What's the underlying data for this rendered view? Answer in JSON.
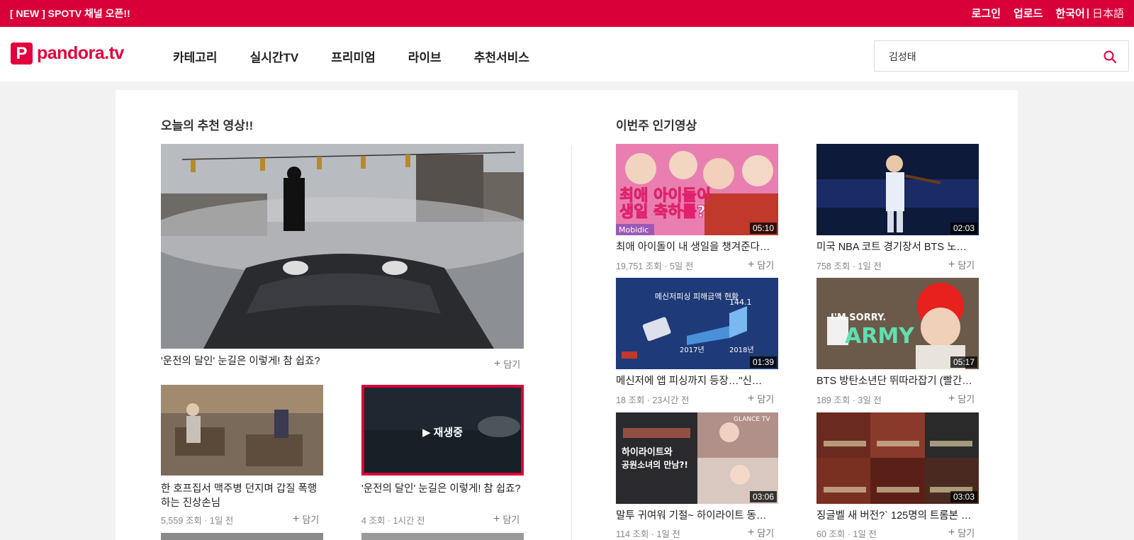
{
  "topbar": {
    "promo": "[ NEW ] SPOTV 채널 오픈!!",
    "login": "로그인",
    "upload": "업로드",
    "lang_ko": "한국어",
    "lang_sep": "|",
    "lang_jp": "日本語"
  },
  "header": {
    "logo_mark": "P",
    "logo_text": "pandora.tv",
    "nav": [
      "카테고리",
      "실시간TV",
      "프리미엄",
      "라이브",
      "추천서비스"
    ],
    "search_value": "김성태"
  },
  "recommended": {
    "title": "오늘의 추천 영상!!",
    "featured": {
      "title": "'운전의 달인' 눈길은 이렇게! 참 쉽죠?",
      "save": "담기"
    },
    "items": [
      {
        "title": "한 호프집서 맥주병 던지며 갑질 폭행하는 진상손님",
        "meta": "5,559 조회 · 1일 전",
        "save": "담기"
      },
      {
        "title": "'운전의 달인' 눈길은 이렇게! 참 쉽죠?",
        "meta": "4 조회 · 1시간 전",
        "save": "담기",
        "playing_label": "▶ 재생중"
      }
    ]
  },
  "popular": {
    "title": "이번주 인기영상",
    "items": [
      {
        "title": "최애 아이돌이 내 생일을 챙겨준다…",
        "meta": "19,751 조회 · 5일 전",
        "duration": "05:10",
        "save": "담기"
      },
      {
        "title": "미국 NBA 코트 경기장서 BTS 노…",
        "meta": "758 조회 · 1일 전",
        "duration": "02:03",
        "save": "담기"
      },
      {
        "title": "메신저에 앱 피싱까지 등장…\"신…",
        "meta": "18 조회 · 23시간 전",
        "duration": "01:39",
        "save": "담기"
      },
      {
        "title": "BTS 방탄소년단 뛰따라잡기 (빨간…",
        "meta": "189 조회 · 3일 전",
        "duration": "05:17",
        "save": "담기"
      },
      {
        "title": "말투 귀여워 기절~ 하이라이트 동…",
        "meta": "114 조회 · 1일 전",
        "duration": "03:06",
        "save": "담기"
      },
      {
        "title": "징글벨 새 버전?` 125명의 트롬본 …",
        "meta": "60 조회 · 1일 전",
        "duration": "03:03",
        "save": "담기"
      }
    ]
  },
  "thumb_texts": {
    "p1_line1": "최애 아이돌이",
    "p1_line2": "생일 축하를?",
    "p1_brand": "Mobidic",
    "p3_head": "메신저피싱 피해금액 현황",
    "p3_y1": "2017년",
    "p3_y2": "2018년",
    "p3_val": "144.1",
    "p4_sorry": "I'M SORRY.",
    "p4_army": "ARMY",
    "p5_brand": "GLANCE TV",
    "p5_l1": "하이라이트와",
    "p5_l2": "공원소녀의 만남?!"
  },
  "colors": {
    "brand": "#d9003a",
    "logo": "#e3003d"
  }
}
